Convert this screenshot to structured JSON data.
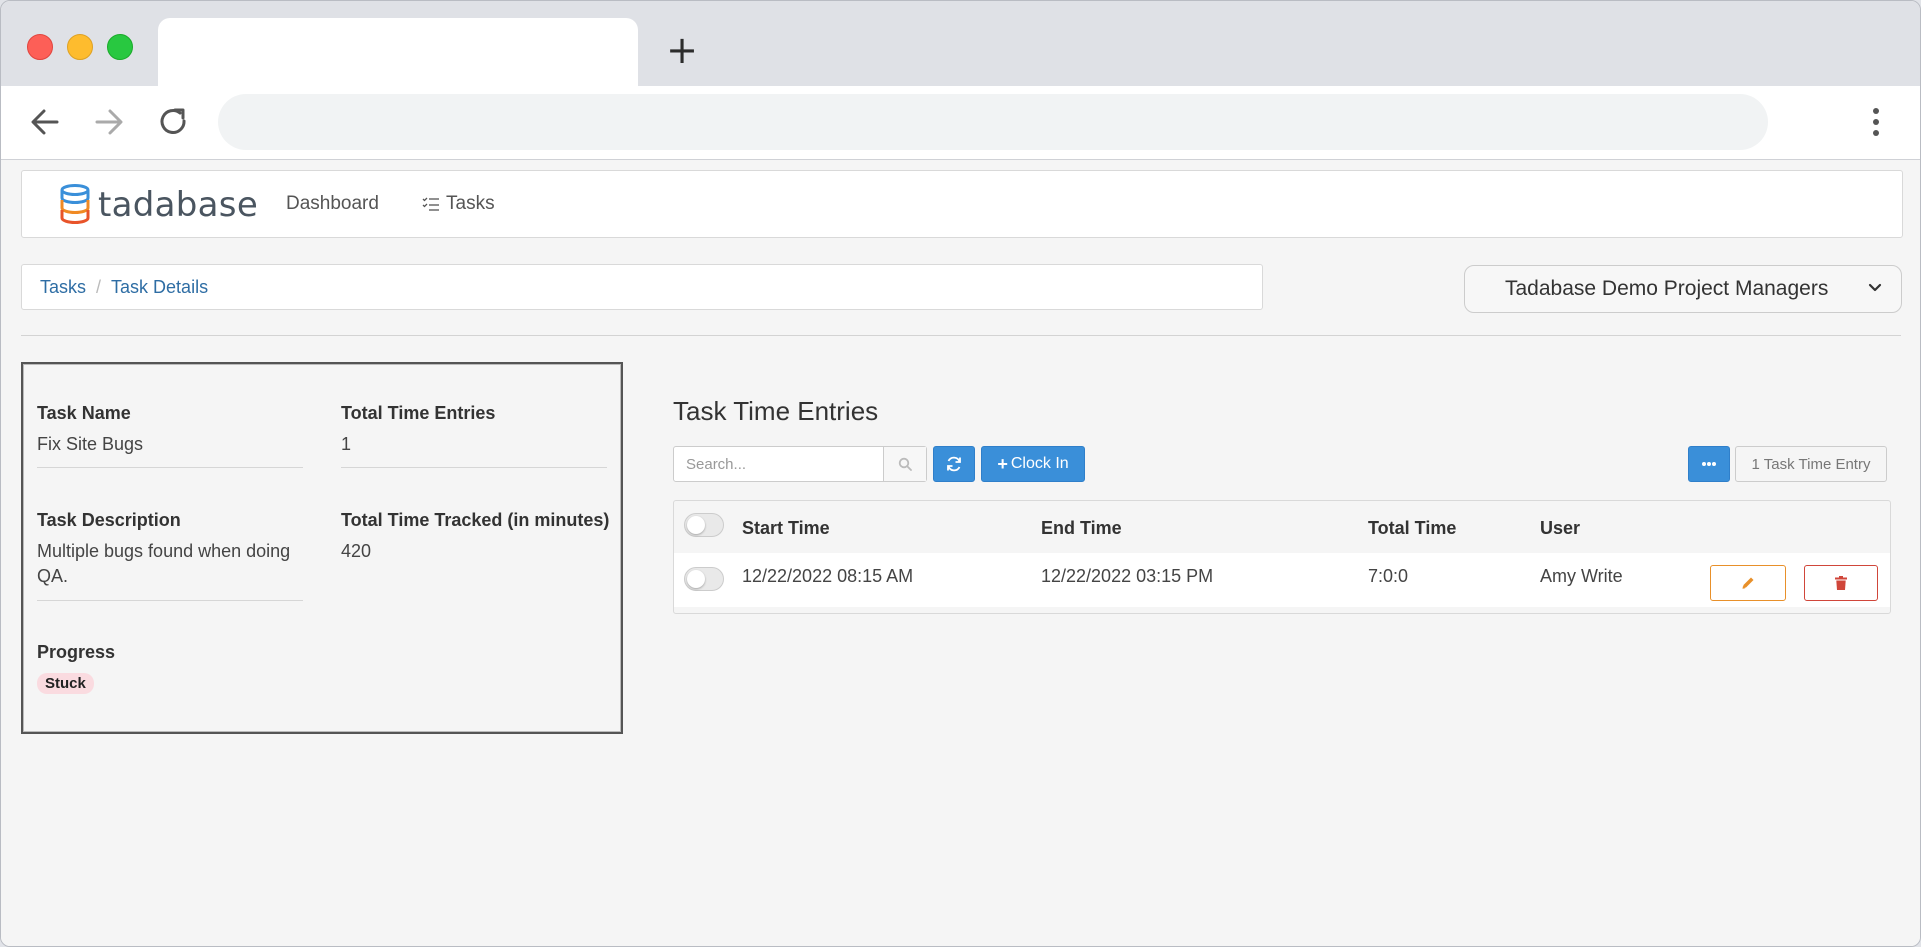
{
  "app": {
    "name": "tadabase",
    "colors": {
      "primary": "#3a8fd9",
      "link": "#2e6da4",
      "edit": "#e8902a",
      "delete": "#d0463a",
      "badge_stuck": "#fadbe0"
    }
  },
  "nav": {
    "items": [
      {
        "label": "Dashboard"
      },
      {
        "label": "Tasks",
        "icon": "list-check-icon"
      }
    ]
  },
  "breadcrumb": {
    "items": [
      {
        "label": "Tasks"
      },
      {
        "label": "Task Details"
      }
    ]
  },
  "role_select": {
    "label": "Tadabase Demo Project Managers"
  },
  "details": {
    "task_name": {
      "label": "Task Name",
      "value": "Fix Site Bugs"
    },
    "total_entries": {
      "label": "Total Time Entries",
      "value": "1"
    },
    "description": {
      "label": "Task Description",
      "value": "Multiple bugs found when doing QA."
    },
    "time_tracked": {
      "label": "Total Time Tracked (in minutes)",
      "value": "420"
    },
    "progress": {
      "label": "Progress",
      "value": "Stuck"
    }
  },
  "time_entries": {
    "title": "Task Time Entries",
    "search_placeholder": "Search...",
    "clock_in_label": "Clock In",
    "count_label": "1 Task Time Entry",
    "columns": [
      "Start Time",
      "End Time",
      "Total Time",
      "User"
    ],
    "rows": [
      {
        "start": "12/22/2022 08:15 AM",
        "end": "12/22/2022 03:15 PM",
        "total": "7:0:0",
        "user": "Amy Write"
      }
    ]
  }
}
